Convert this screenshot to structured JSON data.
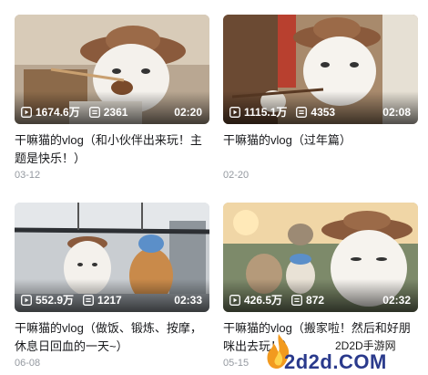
{
  "videos": [
    {
      "plays": "1674.6万",
      "comments": "2361",
      "duration": "02:20",
      "title": "干嘛猫的vlog（和小伙伴出来玩！主题是快乐！）",
      "date": "03-12"
    },
    {
      "plays": "1115.1万",
      "comments": "4353",
      "duration": "02:08",
      "title": "干嘛猫的vlog（过年篇）",
      "date": "02-20"
    },
    {
      "plays": "552.9万",
      "comments": "1217",
      "duration": "02:33",
      "title": "干嘛猫的vlog（做饭、锻炼、按摩，休息日回血的一天~）",
      "date": "06-08"
    },
    {
      "plays": "426.5万",
      "comments": "872",
      "duration": "02:32",
      "title": "干嘛猫的vlog（搬家啦！然后和好朋咪出去玩！）",
      "date": "05-15"
    }
  ],
  "watermark": {
    "site_cn": "2D2D手游网",
    "site_url": "2d2d.COM"
  },
  "icons": {
    "play": "play-count-icon",
    "comment": "comment-count-icon"
  }
}
